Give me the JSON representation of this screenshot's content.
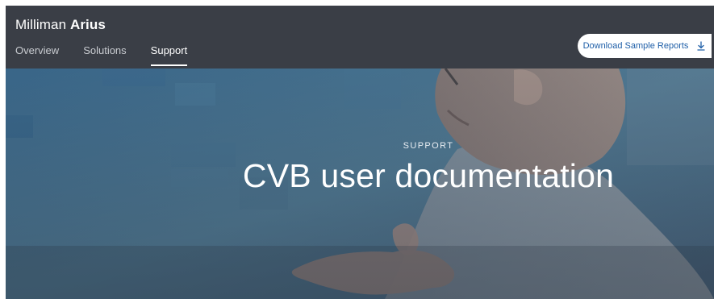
{
  "header": {
    "brand_prefix": "Milliman",
    "brand_name": "Arius",
    "nav": [
      {
        "label": "Overview",
        "active": false
      },
      {
        "label": "Solutions",
        "active": false
      },
      {
        "label": "Support",
        "active": true
      }
    ],
    "download_button": {
      "label": "Download Sample Reports",
      "icon": "download-icon"
    }
  },
  "hero": {
    "eyebrow": "SUPPORT",
    "title": "CVB user documentation"
  },
  "colors": {
    "header_bg": "#3a3e46",
    "link_blue": "#1f5fa8",
    "hero_blue": "#4b7895"
  }
}
